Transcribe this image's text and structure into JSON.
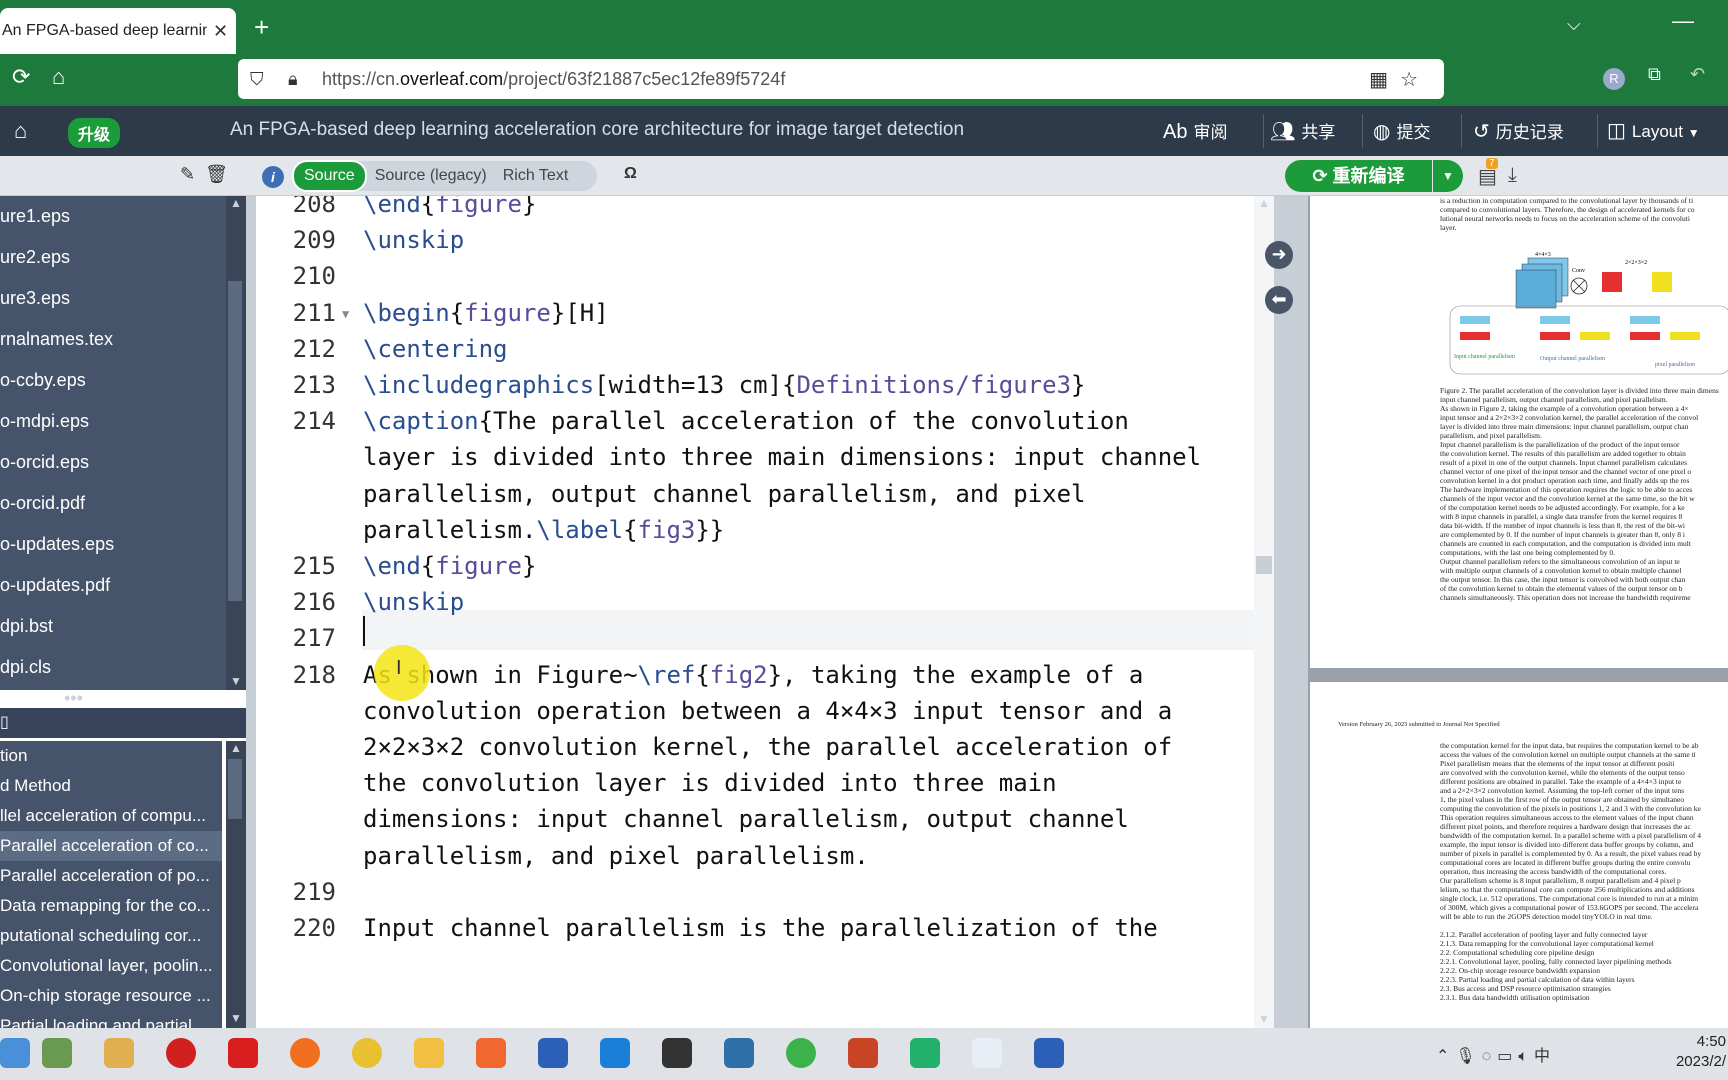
{
  "browser": {
    "tab_title": "An FPGA-based deep learning",
    "url_prefix": "https://cn.",
    "url_domain": "overleaf.com",
    "url_path": "/project/63f21887c5ec12fe89f5724f"
  },
  "overleaf": {
    "upgrade_label": "升级",
    "project_title": "An FPGA-based deep learning acceleration core architecture for image target detection",
    "review_label": "审阅",
    "share_label": "共享",
    "submit_label": "提交",
    "history_label": "历史记录",
    "layout_label": "Layout",
    "recompile_label": "重新编译",
    "logs_badge": "7",
    "modes": [
      "Source",
      "Source (legacy)",
      "Rich Text"
    ],
    "omega_label": "Ω"
  },
  "files": [
    "ure1.eps",
    "ure2.eps",
    "ure3.eps",
    "rnalnames.tex",
    "o-ccby.eps",
    "o-mdpi.eps",
    "o-orcid.eps",
    "o-orcid.pdf",
    "o-updates.eps",
    "o-updates.pdf",
    "dpi.bst",
    "dpi.cls"
  ],
  "outline": [
    "tion",
    "d Method",
    "llel acceleration of compu...",
    "Parallel acceleration of co...",
    "Parallel acceleration of po...",
    "Data remapping for the co...",
    "putational scheduling cor...",
    "Convolutional layer, poolin...",
    "On-chip storage resource ...",
    "Partial loading and partial..."
  ],
  "editor_lines": [
    {
      "num": "208",
      "text": "\\end{figure}"
    },
    {
      "num": "209",
      "text": "\\unskip"
    },
    {
      "num": "210",
      "text": ""
    },
    {
      "num": "211",
      "text": "\\begin{figure}[H]"
    },
    {
      "num": "212",
      "text": "\\centering"
    },
    {
      "num": "213",
      "text": "\\includegraphics[width=13 cm]{Definitions/figure3}"
    },
    {
      "num": "214",
      "text": "\\caption{The parallel acceleration of the convolution"
    },
    {
      "num": "",
      "text": "layer is divided into three main dimensions: input channel"
    },
    {
      "num": "",
      "text": "parallelism, output channel parallelism, and pixel"
    },
    {
      "num": "",
      "text": "parallelism.\\label{fig3}}"
    },
    {
      "num": "215",
      "text": "\\end{figure}"
    },
    {
      "num": "216",
      "text": "\\unskip"
    },
    {
      "num": "217",
      "text": ""
    },
    {
      "num": "218",
      "text": "As shown in Figure~\\ref{fig2}, taking the example of a"
    },
    {
      "num": "",
      "text": "convolution operation between a 4×4×3 input tensor and a"
    },
    {
      "num": "",
      "text": "2×2×3×2 convolution kernel, the parallel acceleration of"
    },
    {
      "num": "",
      "text": "the convolution layer is divided into three main"
    },
    {
      "num": "",
      "text": "dimensions: input channel parallelism, output channel"
    },
    {
      "num": "",
      "text": "parallelism, and pixel parallelism."
    },
    {
      "num": "219",
      "text": ""
    },
    {
      "num": "220",
      "text": "Input channel parallelism is the parallelization of the"
    }
  ],
  "pdf": {
    "page1_top": [
      "is a reduction in computation compared to the convolutional layer by thousands of ti",
      "compared to convolutional layers. Therefore, the design of accelerated kernels for co",
      "lutional neural networks needs to focus on the acceleration scheme of the convoluti",
      "layer."
    ],
    "fig_labels": [
      "4×4×3",
      "Conv",
      "2×2×3×2",
      "Input channel parallelism",
      "Output channel parallelism",
      "pixel parallelism"
    ],
    "page1_body": [
      "Figure 2. The parallel acceleration of the convolution layer is divided into three main dimens",
      "input channel parallelism, output channel parallelism, and pixel parallelism.",
      "     As shown in Figure 2, taking the example of a convolution operation between a 4×",
      "input tensor and a 2×2×3×2 convolution kernel, the parallel acceleration of the convol",
      "layer is divided into three main dimensions: input channel parallelism, output chan",
      "parallelism, and pixel parallelism.",
      "     Input channel parallelism is the parallelization of the product of the input tensor",
      "the convolution kernel. The results of this parallelism are added together to obtain",
      "result of a pixel in one of the output channels. Input channel parallelism calculates",
      "channel vector of one pixel of the input tensor and the channel vector of one pixel o",
      "convolution kernel in a dot product operation each time, and finally adds up the res",
      "The hardware implementation of this operation requires the logic to be able to acces",
      "channels of the input vector and the convolution kernel at the same time, so the bit w",
      "of the computation kernel needs to be adjusted accordingly. For example, for a ke",
      "with 8 input channels in parallel, a single data transfer from the kernel requires 8",
      "data bit-width. If the number of input channels is less than 8, the rest of the bit-wi",
      "are complemented by 0. If the number of input channels is greater than 8, only 8 i",
      "channels are counted in each computation, and the computation is divided into mult",
      "computations, with the last one being complemented by 0.",
      "     Output channel parallelism refers to the simultaneous convolution of an input te",
      "with multiple output channels of a convolution kernel to obtain multiple channel",
      "the output tensor. In this case, the input tensor is convolved with both output chan",
      "of the convolution kernel to obtain the elemental values of the output tensor on b",
      "channels simultaneously. This operation does not increase the bandwidth requireme"
    ],
    "page2_header": "Version February 26, 2023 submitted to Journal Not Specified",
    "page2_body": [
      "the computation kernel for the input data, but requires the computation kernel to be ab",
      "access the values of the convolution kernel on multiple output channels at the same ti",
      "     Pixel parallelism means that the elements of the input tensor at different positi",
      "are convolved with the convolution kernel, while the elements of the output tenso",
      "different positions are obtained in parallel. Take the example of a 4×4×3 input te",
      "and a 2×2×3×2 convolution kernel. Assuming the top-left corner of the input tens",
      "1, the pixel values in the first row of the output tensor are obtained by simultaneo",
      "computing the convolution of the pixels in positions 1, 2 and 3 with the convolution ke",
      "This operation requires simultaneous access to the element values of the input chann",
      "different pixel points, and therefore requires a hardware design that increases the ac",
      "bandwidth of the computation kernel. In a parallel scheme with a pixel parallelism of 4",
      "example, the input tensor is divided into different data buffer groups by column, and",
      "number of pixels in parallel is complemented by 0. As a result, the pixel values read by",
      "computational cores are located in different buffer groups during the entire convolu",
      "operation, thus increasing the access bandwidth of the computational cores.",
      "     Our parallelism scheme is 8 input parallelism, 8 output parallelism and 4 pixel p",
      "lelism, so that the computational core can compute 256 multiplications and additions",
      "single clock, i.e. 512 operations. The computational core is intended to run at a minim",
      "of 300M, which gives a computational power of 153.6GOPS per second. The accelera",
      "will be able to run the 2GOPS detection model tinyYOLO in real time.",
      "",
      "2.1.2. Parallel acceleration of pooling layer and fully connected layer",
      "2.1.3. Data remapping for the convolutional layer computational kernel",
      "2.2. Computational scheduling core pipeline design",
      "2.2.1. Convolutional layer, pooling, fully connected layer pipelining methods",
      "2.2.2. On-chip storage resource bandwidth expansion",
      "2.2.3. Partial loading and partial calculation of data within layers",
      "2.3. Bus access and DSP resource optimisation strategies",
      "2.3.1. Bus data bandwidth utilisation optimisation"
    ]
  },
  "taskbar": {
    "clock_time": "4:50",
    "clock_date": "2023/2/",
    "tray_lang": "中"
  }
}
